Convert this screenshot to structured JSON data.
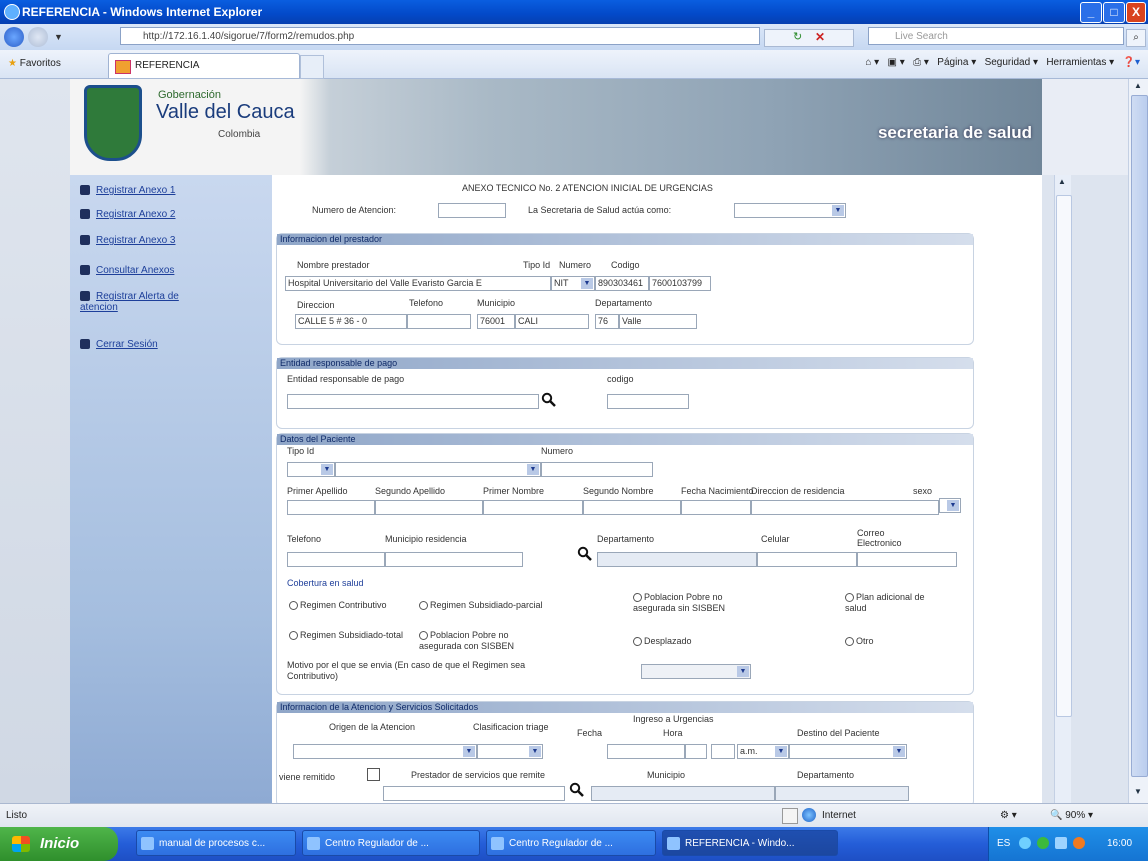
{
  "window": {
    "title": "REFERENCIA - Windows Internet Explorer",
    "buttons": {
      "minimize": "_",
      "maximize": "□",
      "close": "X"
    }
  },
  "browser": {
    "address": "http://172.16.1.40/sigorue/7/form2/remudos.php",
    "search_placeholder": "Live Search",
    "favorites_label": "Favoritos",
    "tab_label": "REFERENCIA",
    "command_bar": {
      "page": "Página",
      "security": "Seguridad",
      "tools": "Herramientas"
    }
  },
  "banner": {
    "gobernacion": "Gobernación",
    "valle": "Valle del Cauca",
    "colombia": "Colombia",
    "secretaria": "secretaria de salud"
  },
  "sidebar": {
    "items": [
      {
        "label": "Registrar Anexo 1"
      },
      {
        "label": "Registrar Anexo 2"
      },
      {
        "label": "Registrar Anexo 3"
      },
      {
        "label": "Consultar Anexos"
      },
      {
        "label": "Registrar Alerta de atencion"
      },
      {
        "label": "Cerrar Sesión"
      }
    ]
  },
  "form": {
    "heading": "ANEXO TECNICO No. 2 ATENCION INICIAL DE URGENCIAS",
    "numero_atencion_label": "Numero de Atencion:",
    "secretaria_label": "La Secretaria de Salud actúa como:",
    "prestador": {
      "header": "Informacion del prestador",
      "nombre_label": "Nombre prestador",
      "tipo_id_label": "Tipo Id",
      "numero_label": "Numero",
      "codigo_label": "Codigo",
      "nombre_value": "Hospital Universitario del Valle Evaristo Garcia E",
      "tipo_id_value": "NIT",
      "numero_value": "890303461",
      "codigo_value": "7600103799",
      "direccion_label": "Direccion",
      "telefono_label": "Telefono",
      "municipio_label": "Municipio",
      "departamento_label": "Departamento",
      "direccion_value": "CALLE 5 # 36 - 0",
      "municipio_code": "76001",
      "municipio_name": "CALI",
      "departamento_code": "76",
      "departamento_name": "Valle"
    },
    "entidad": {
      "header": "Entidad responsable de pago",
      "entidad_label": "Entidad responsable de pago",
      "codigo_label": "codigo"
    },
    "paciente": {
      "header": "Datos del Paciente",
      "tipo_id_label": "Tipo Id",
      "numero_label": "Numero",
      "primer_apellido": "Primer Apellido",
      "segundo_apellido": "Segundo Apellido",
      "primer_nombre": "Primer Nombre",
      "segundo_nombre": "Segundo Nombre",
      "fecha_nacimiento": "Fecha Nacimiento",
      "direccion_residencia": "Direccion de residencia",
      "sexo": "sexo",
      "telefono": "Telefono",
      "municipio_residencia": "Municipio residencia",
      "departamento": "Departamento",
      "celular": "Celular",
      "correo": "Correo Electronico",
      "cobertura_label": "Cobertura en salud",
      "cobertura_options": [
        "Regimen Contributivo",
        "Regimen Subsidiado-parcial",
        "Poblacion Pobre no asegurada sin SISBEN",
        "Plan adicional de salud",
        "Regimen Subsidiado-total",
        "Poblacion Pobre no asegurada con SISBEN",
        "Desplazado",
        "Otro"
      ],
      "motivo_label": "Motivo por el que se envia (En caso de que el Regimen sea Contributivo)"
    },
    "atencion": {
      "header": "Informacion de la Atencion y Servicios Solicitados",
      "origen_label": "Origen de la Atencion",
      "triage_label": "Clasificacion triage",
      "ingreso_label": "Ingreso a Urgencias",
      "fecha_label": "Fecha",
      "hora_label": "Hora",
      "ampm_value": "a.m.",
      "destino_label": "Destino del Paciente",
      "remitido_label": "viene remitido",
      "prestador_remite_label": "Prestador de servicios que remite",
      "municipio_label": "Municipio",
      "departamento_label": "Departamento"
    }
  },
  "statusbar": {
    "left": "Listo",
    "zone": "Internet",
    "zoom": "90%"
  },
  "taskbar": {
    "start": "Inicio",
    "tasks": [
      {
        "label": "manual de procesos c..."
      },
      {
        "label": "Centro Regulador de ..."
      },
      {
        "label": "Centro Regulador de ..."
      },
      {
        "label": "REFERENCIA - Windo..."
      }
    ],
    "lang": "ES",
    "time": "16:00"
  }
}
